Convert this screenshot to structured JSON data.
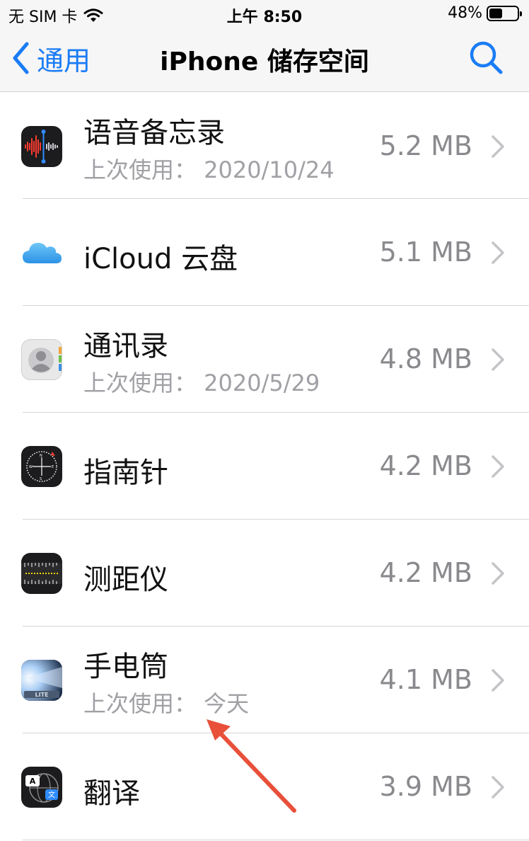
{
  "status": {
    "carrier": "无 SIM 卡",
    "time": "上午 8:50",
    "battery": "48%",
    "battery_level": 0.48
  },
  "nav": {
    "back_label": "通用",
    "title": "iPhone 储存空间"
  },
  "apps": [
    {
      "name": "语音备忘录",
      "last_used": "上次使用：  2020/10/24",
      "size": "5.2 MB",
      "icon": "voice-memos-icon"
    },
    {
      "name": "iCloud 云盘",
      "last_used": "",
      "size": "5.1 MB",
      "icon": "icloud-drive-icon"
    },
    {
      "name": "通讯录",
      "last_used": "上次使用：  2020/5/29",
      "size": "4.8 MB",
      "icon": "contacts-icon"
    },
    {
      "name": "指南针",
      "last_used": "",
      "size": "4.2 MB",
      "icon": "compass-icon"
    },
    {
      "name": "测距仪",
      "last_used": "",
      "size": "4.2 MB",
      "icon": "measure-icon"
    },
    {
      "name": "手电筒",
      "last_used": "上次使用：  今天",
      "size": "4.1 MB",
      "icon": "flashlight-icon"
    },
    {
      "name": "翻译",
      "last_used": "",
      "size": "3.9 MB",
      "icon": "translate-icon"
    }
  ],
  "colors": {
    "accent": "#1a7cf5",
    "annotation_arrow": "#e8503a"
  }
}
